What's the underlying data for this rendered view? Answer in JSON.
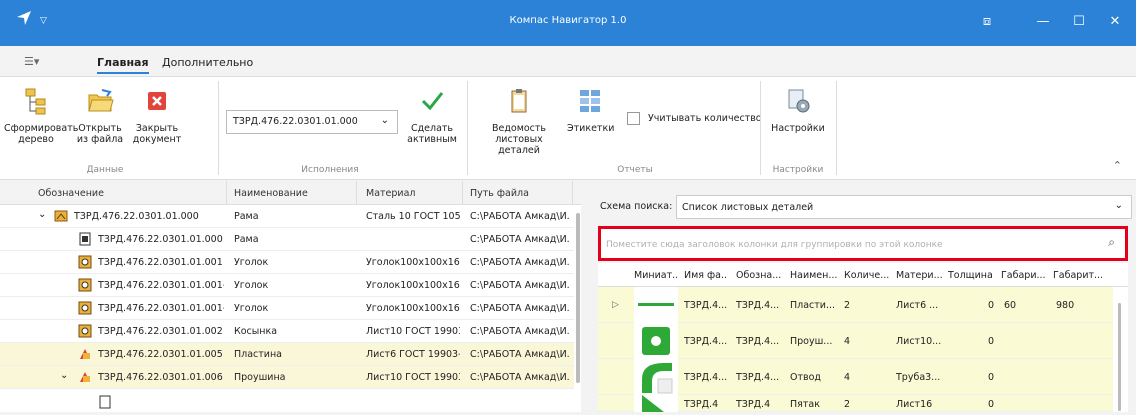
{
  "app": {
    "title": "Компас Навигатор 1.0"
  },
  "tabs": {
    "home": "Главная",
    "extra": "Дополнительно"
  },
  "ribbon": {
    "build_tree": [
      "Сформировать",
      "дерево"
    ],
    "open_file": [
      "Открыть",
      "из файла"
    ],
    "close_doc": [
      "Закрыть",
      "документ"
    ],
    "group_data": "Данные",
    "execution_value": "ТЗРД.476.22.0301.01.000",
    "make_active": [
      "Сделать",
      "активным"
    ],
    "group_exec": "Исполнения",
    "sheet_list": [
      "Ведомость",
      "листовых деталей"
    ],
    "labels": "Этикетки",
    "count_qty": "Учитывать количество",
    "group_reports": "Отчеты",
    "settings": "Настройки",
    "group_settings": "Настройки"
  },
  "tree": {
    "headers": [
      "Обозначение",
      "Наименование",
      "Материал",
      "Путь файла"
    ],
    "rows": [
      {
        "code": "ТЗРД.476.22.0301.01.000",
        "name": "Рама",
        "mat": "Сталь 10 ГОСТ 105...",
        "path": "C:\\РАБОТА Амкад\\И..."
      },
      {
        "code": "ТЗРД.476.22.0301.01.000",
        "name": "Рама",
        "mat": "",
        "path": "C:\\РАБОТА Амкад\\И..."
      },
      {
        "code": "ТЗРД.476.22.0301.01.001",
        "name": "Уголок",
        "mat": "Уголок100x100x16 ...",
        "path": "C:\\РАБОТА Амкад\\И..."
      },
      {
        "code": "ТЗРД.476.22.0301.01.001-...",
        "name": "Уголок",
        "mat": "Уголок100x100x16 ...",
        "path": "C:\\РАБОТА Амкад\\И..."
      },
      {
        "code": "ТЗРД.476.22.0301.01.001-...",
        "name": "Уголок",
        "mat": "Уголок100x100x16 ...",
        "path": "C:\\РАБОТА Амкад\\И..."
      },
      {
        "code": "ТЗРД.476.22.0301.01.002",
        "name": "Косынка",
        "mat": "Лист10 ГОСТ 19903...",
        "path": "C:\\РАБОТА Амкад\\И..."
      },
      {
        "code": "ТЗРД.476.22.0301.01.005",
        "name": "Пластина",
        "mat": "Лист6 ГОСТ 19903-...",
        "path": "C:\\РАБОТА Амкад\\И..."
      },
      {
        "code": "ТЗРД.476.22.0301.01.006",
        "name": "Проушина",
        "mat": "Лист10 ГОСТ 19903...",
        "path": "C:\\РАБОТА Амкад\\И..."
      }
    ]
  },
  "search": {
    "schema_label": "Схема поиска:",
    "schema_value": "Список листовых деталей",
    "group_placeholder": "Поместите сюда заголовок колонки для группировки по этой колонке"
  },
  "grid": {
    "headers": [
      "Миниат...",
      "Имя фа...",
      "Обозна...",
      "Наимен...",
      "Количе...",
      "Матери...",
      "Толщина",
      "Габари...",
      "Габарит..."
    ],
    "rows": [
      {
        "file": "ТЗРД.4...",
        "code": "ТЗРД.4...",
        "name": "Пласти...",
        "qty": "2",
        "mat": "Лист6 ...",
        "thick": "0",
        "g1": "60",
        "g2": "980"
      },
      {
        "file": "ТЗРД.4...",
        "code": "ТЗРД.4...",
        "name": "Проуш...",
        "qty": "4",
        "mat": "Лист10...",
        "thick": "0",
        "g1": "",
        "g2": ""
      },
      {
        "file": "ТЗРД.4...",
        "code": "ТЗРД.4...",
        "name": "Отвод",
        "qty": "4",
        "mat": "Труба3...",
        "thick": "0",
        "g1": "",
        "g2": ""
      },
      {
        "file": "ТЗРД.4",
        "code": "ТЗРД.4",
        "name": "Пятак",
        "qty": "2",
        "mat": "Лист16",
        "thick": "0",
        "g1": "",
        "g2": ""
      }
    ]
  }
}
